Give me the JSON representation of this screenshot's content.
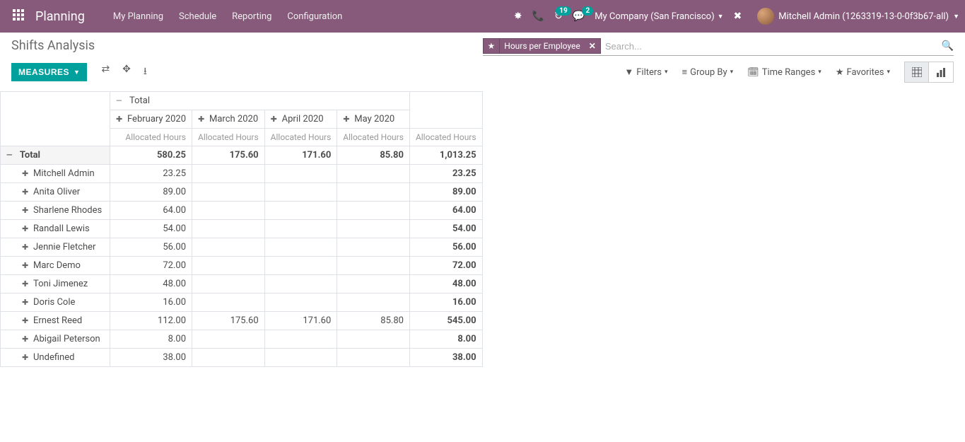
{
  "nav": {
    "brand": "Planning",
    "menu": [
      "My Planning",
      "Schedule",
      "Reporting",
      "Configuration"
    ],
    "company": "My Company (San Francisco)",
    "user": "Mitchell Admin (1263319-13-0-0f3b67-all)",
    "badge_clock": "19",
    "badge_chat": "2"
  },
  "breadcrumb": "Shifts Analysis",
  "search": {
    "facet": "Hours per Employee",
    "placeholder": "Search..."
  },
  "toolbar": {
    "measures": "MEASURES",
    "filters": "Filters",
    "groupby": "Group By",
    "timeranges": "Time Ranges",
    "favorites": "Favorites"
  },
  "pivot": {
    "top_total": "Total",
    "months": [
      "February 2020",
      "March 2020",
      "April 2020",
      "May 2020"
    ],
    "measure_label": "Allocated Hours",
    "row_total_label": "Total",
    "totals": {
      "feb": "580.25",
      "mar": "175.60",
      "apr": "171.60",
      "may": "85.80",
      "sum": "1,013.25"
    },
    "rows": [
      {
        "name": "Mitchell Admin",
        "feb": "23.25",
        "mar": "",
        "apr": "",
        "may": "",
        "sum": "23.25"
      },
      {
        "name": "Anita Oliver",
        "feb": "89.00",
        "mar": "",
        "apr": "",
        "may": "",
        "sum": "89.00"
      },
      {
        "name": "Sharlene Rhodes",
        "feb": "64.00",
        "mar": "",
        "apr": "",
        "may": "",
        "sum": "64.00"
      },
      {
        "name": "Randall Lewis",
        "feb": "54.00",
        "mar": "",
        "apr": "",
        "may": "",
        "sum": "54.00"
      },
      {
        "name": "Jennie Fletcher",
        "feb": "56.00",
        "mar": "",
        "apr": "",
        "may": "",
        "sum": "56.00"
      },
      {
        "name": "Marc Demo",
        "feb": "72.00",
        "mar": "",
        "apr": "",
        "may": "",
        "sum": "72.00"
      },
      {
        "name": "Toni Jimenez",
        "feb": "48.00",
        "mar": "",
        "apr": "",
        "may": "",
        "sum": "48.00"
      },
      {
        "name": "Doris Cole",
        "feb": "16.00",
        "mar": "",
        "apr": "",
        "may": "",
        "sum": "16.00"
      },
      {
        "name": "Ernest Reed",
        "feb": "112.00",
        "mar": "175.60",
        "apr": "171.60",
        "may": "85.80",
        "sum": "545.00"
      },
      {
        "name": "Abigail Peterson",
        "feb": "8.00",
        "mar": "",
        "apr": "",
        "may": "",
        "sum": "8.00"
      },
      {
        "name": "Undefined",
        "feb": "38.00",
        "mar": "",
        "apr": "",
        "may": "",
        "sum": "38.00"
      }
    ]
  }
}
